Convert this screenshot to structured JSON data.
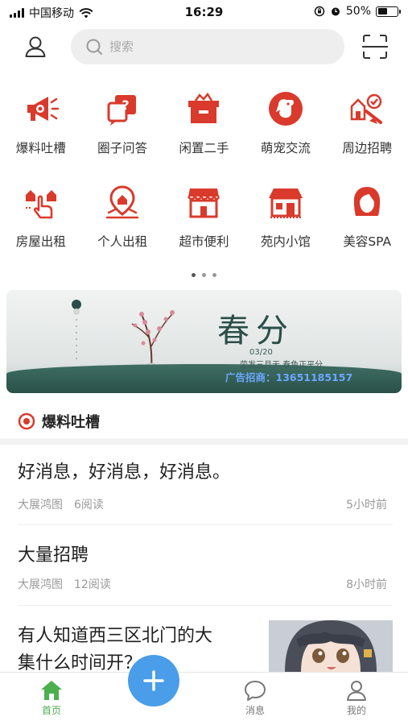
{
  "status_bar": {
    "carrier": "中国移动",
    "time": "16:29",
    "battery": "50%",
    "battery_level": 0.5
  },
  "header": {
    "search_placeholder": "搜索",
    "icons": [
      "user-icon",
      "search-icon",
      "scan-icon"
    ]
  },
  "categories": [
    {
      "label": "爆料吐槽",
      "icon": "megaphone-icon"
    },
    {
      "label": "圈子问答",
      "icon": "qa-icon"
    },
    {
      "label": "闲置二手",
      "icon": "box-icon"
    },
    {
      "label": "萌宠交流",
      "icon": "pet-icon"
    },
    {
      "label": "周边招聘",
      "icon": "recruit-icon"
    },
    {
      "label": "房屋出租",
      "icon": "house-rent-icon"
    },
    {
      "label": "个人出租",
      "icon": "location-house-icon"
    },
    {
      "label": "超市便利",
      "icon": "store-icon"
    },
    {
      "label": "苑内小馆",
      "icon": "shop-icon"
    },
    {
      "label": "美容SPA",
      "icon": "beauty-icon"
    }
  ],
  "pager": {
    "count": 3,
    "active": 0
  },
  "banner": {
    "title": "春分",
    "date": "03/20",
    "subtitle": "荣发三月天  春色正平分",
    "ad_text": "广告招商：13651185157"
  },
  "section": {
    "title": "爆料吐槽"
  },
  "news": [
    {
      "title": "好消息，好消息，好消息。",
      "author": "大展鸿图",
      "reads": "6阅读",
      "time": "5小时前"
    },
    {
      "title": "大量招聘",
      "author": "大展鸿图",
      "reads": "12阅读",
      "time": "8小时前"
    },
    {
      "title_line1": "有人知道西三区北门的大",
      "title_line2": "集什么时间开？"
    }
  ],
  "tabbar": {
    "items": [
      {
        "label": "首页",
        "icon": "home-icon",
        "active": true
      },
      {
        "label": "",
        "icon": "plus-icon"
      },
      {
        "label": "消息",
        "icon": "message-icon"
      },
      {
        "label": "我的",
        "icon": "profile-icon"
      }
    ]
  },
  "colors": {
    "accent_red": "#d93a2b",
    "tab_active": "#4caf50",
    "fab": "#4a9de8"
  }
}
